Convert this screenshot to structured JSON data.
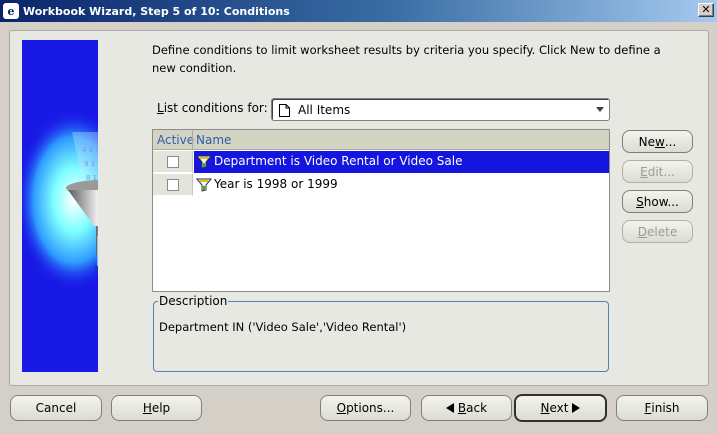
{
  "window": {
    "title": "Workbook Wizard, Step 5 of 10: Conditions",
    "close_label": "✕"
  },
  "instructions": "Define conditions to limit worksheet results by criteria you specify. Click New to define a new condition.",
  "list_conditions": {
    "label_mnemonic": "L",
    "label_rest": "ist conditions for:",
    "selected_value": "All Items"
  },
  "table": {
    "columns": [
      "Active",
      "Name"
    ],
    "rows": [
      {
        "name": "Department is Video Rental or Video Sale",
        "active": false,
        "selected": true
      },
      {
        "name": "Year is 1998 or 1999",
        "active": false,
        "selected": false
      }
    ]
  },
  "side_buttons": {
    "new": {
      "mnemonic": "w",
      "before": "Ne",
      "after": "...",
      "enabled": true
    },
    "edit": {
      "mnemonic": "E",
      "before": "",
      "after": "dit...",
      "enabled": false
    },
    "show": {
      "mnemonic": "S",
      "before": "",
      "after": "how...",
      "enabled": true
    },
    "delete": {
      "mnemonic": "D",
      "before": "",
      "after": "elete",
      "enabled": false
    }
  },
  "description": {
    "legend": "Description",
    "text": "Department IN ('Video Sale','Video Rental')"
  },
  "footer": {
    "cancel": "Cancel",
    "help": {
      "mnemonic": "H",
      "rest": "elp"
    },
    "options": {
      "mnemonic": "O",
      "rest": "ptions..."
    },
    "back": {
      "mnemonic": "B",
      "rest": "ack"
    },
    "next": {
      "mnemonic": "N",
      "rest": "ext"
    },
    "finish": {
      "mnemonic": "F",
      "rest": "inish"
    }
  },
  "colors": {
    "title_bar": "#0a246a",
    "selection": "#1515e0",
    "side_panel": "#1919e6",
    "dialog_bg": "#d4d0c8"
  },
  "icons": [
    "app-icon",
    "close-icon",
    "document-icon",
    "filter-funnel-icon",
    "back-arrow-icon",
    "next-arrow-icon",
    "funnel-illustration"
  ]
}
